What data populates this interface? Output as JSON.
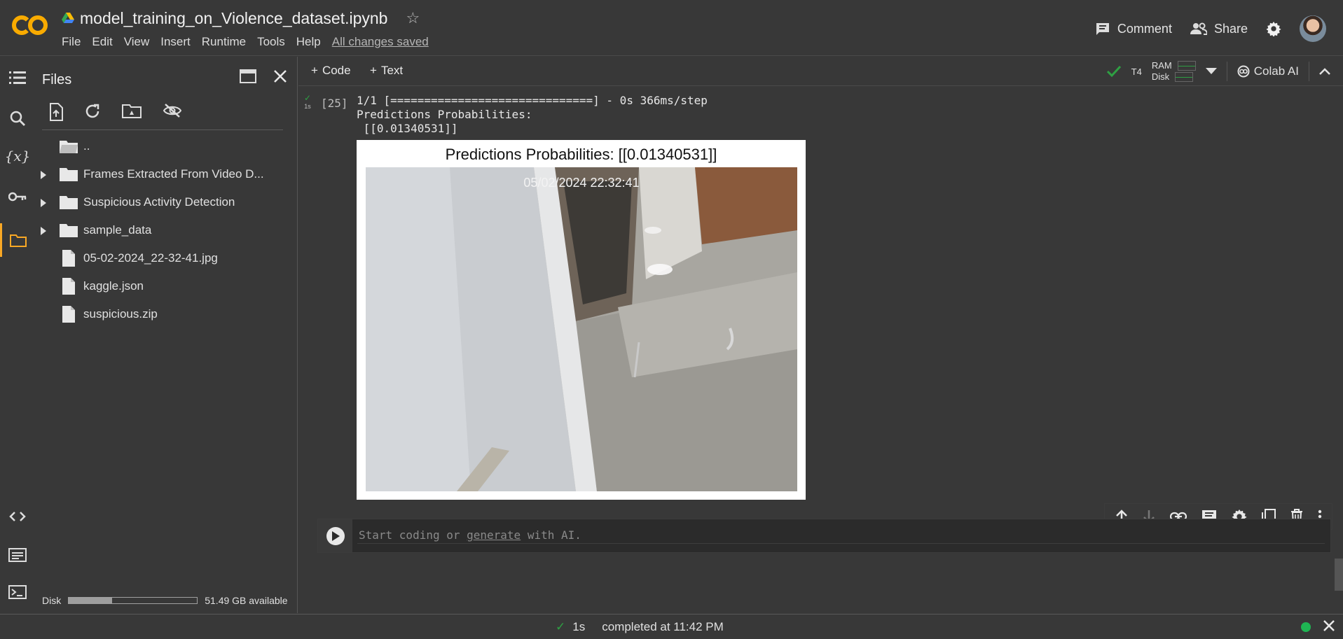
{
  "app": {
    "logo_text": "CO",
    "notebook_title": "model_training_on_Violence_dataset.ipynb"
  },
  "menu": [
    "File",
    "Edit",
    "View",
    "Insert",
    "Runtime",
    "Tools",
    "Help"
  ],
  "save_status": "All changes saved",
  "header_buttons": {
    "comment": "Comment",
    "share": "Share"
  },
  "sidebar": {
    "title": "Files"
  },
  "file_tree": [
    {
      "name": "..",
      "type": "parent"
    },
    {
      "name": "Frames Extracted From Video D...",
      "type": "folder"
    },
    {
      "name": "Suspicious Activity Detection",
      "type": "folder"
    },
    {
      "name": "sample_data",
      "type": "folder"
    },
    {
      "name": "05-02-2024_22-32-41.jpg",
      "type": "file"
    },
    {
      "name": "kaggle.json",
      "type": "file"
    },
    {
      "name": "suspicious.zip",
      "type": "file"
    }
  ],
  "disk": {
    "label": "Disk",
    "available": "51.49 GB available",
    "used_fraction": 0.34
  },
  "toolbar": {
    "add_code": "Code",
    "add_text": "Text",
    "runtime": "T4",
    "ram": "RAM",
    "disk": "Disk",
    "colab_ai": "Colab AI"
  },
  "cell": {
    "exec_count": "[25]",
    "exec_time": "1s",
    "output_text": "1/1 [==============================] - 0s 366ms/step\nPredictions Probabilities:\n [[0.01340531]]",
    "plot_title": "Predictions Probabilities: [[0.01340531]]",
    "image_timestamp": "05/02/2024  22:32:41"
  },
  "new_cell": {
    "placeholder_before": "Start coding or ",
    "placeholder_link": "generate",
    "placeholder_after": " with AI."
  },
  "status": {
    "duration": "1s",
    "message": "completed at 11:42 PM"
  },
  "colors": {
    "logo_orange": "#f9ab00",
    "success_green": "#2ea043",
    "status_dot": "#1fb553"
  }
}
